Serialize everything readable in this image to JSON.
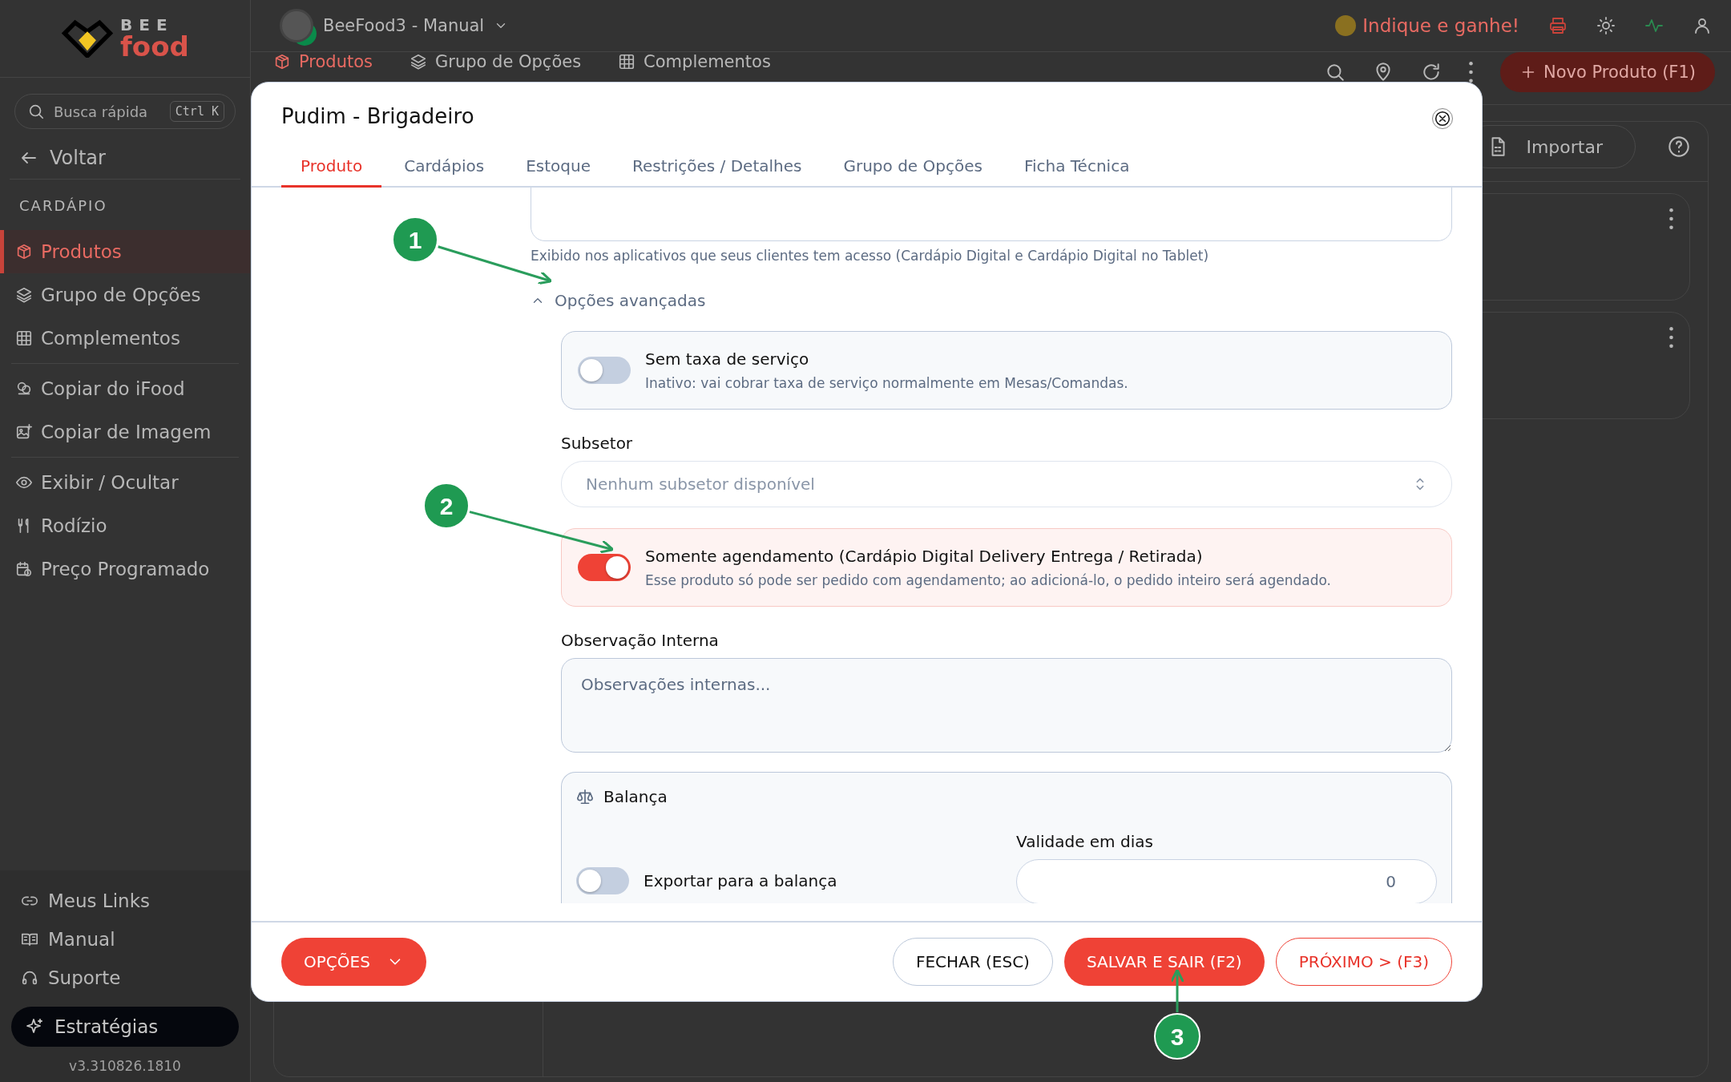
{
  "sidebar": {
    "logo": {
      "top": "BEE",
      "bottom": "food"
    },
    "search": {
      "placeholder": "Busca rápida",
      "shortcut": "Ctrl K"
    },
    "back": "Voltar",
    "section": "CARDÁPIO",
    "groups": [
      [
        {
          "label": "Produtos",
          "selected": true
        },
        {
          "label": "Grupo de Opções",
          "selected": false
        },
        {
          "label": "Complementos",
          "selected": false
        }
      ],
      [
        {
          "label": "Copiar do iFood",
          "selected": false
        },
        {
          "label": "Copiar de Imagem",
          "selected": false
        }
      ],
      [
        {
          "label": "Exibir / Ocultar",
          "selected": false
        },
        {
          "label": "Rodízio",
          "selected": false
        },
        {
          "label": "Preço Programado",
          "selected": false
        }
      ]
    ],
    "footer_links": [
      "Meus Links",
      "Manual",
      "Suporte"
    ],
    "strategy_button": "Estratégias",
    "version": "v3.310826.1810"
  },
  "topbar": {
    "workspace": "BeeFood3 - Manual",
    "referral": "Indique e ganhe!"
  },
  "page": {
    "tabs": [
      {
        "label": "Produtos",
        "selected": true
      },
      {
        "label": "Grupo de Opções",
        "selected": false
      },
      {
        "label": "Complementos",
        "selected": false
      }
    ],
    "new_button": "Novo Produto (F1)",
    "import_button": "Importar",
    "cards": [
      {
        "kind": "product"
      },
      {
        "kind": "product"
      }
    ]
  },
  "modal": {
    "title": "Pudim - Brigadeiro",
    "tabs": [
      {
        "label": "Produto",
        "selected": true
      },
      {
        "label": "Cardápios",
        "selected": false
      },
      {
        "label": "Estoque",
        "selected": false
      },
      {
        "label": "Restrições / Detalhes",
        "selected": false
      },
      {
        "label": "Grupo de Opções",
        "selected": false
      },
      {
        "label": "Ficha Técnica",
        "selected": false
      }
    ],
    "description_hint": "Exibido nos aplicativos que seus clientes tem acesso (Cardápio Digital e Cardápio Digital no Tablet)",
    "advanced": {
      "label": "Opções avançadas",
      "expanded": true
    },
    "service_fee": {
      "title": "Sem taxa de serviço",
      "hint": "Inativo: vai cobrar taxa de serviço normalmente em Mesas/Comandas.",
      "on": false
    },
    "subsector": {
      "label": "Subsetor",
      "placeholder": "Nenhum subsetor disponível"
    },
    "scheduling": {
      "title": "Somente agendamento (Cardápio Digital Delivery Entrega / Retirada)",
      "hint": "Esse produto só pode ser pedido com agendamento; ao adicioná-lo, o pedido inteiro será agendado.",
      "on": true
    },
    "internal_note": {
      "label": "Observação Interna",
      "placeholder": "Observações internas..."
    },
    "scale": {
      "title": "Balança",
      "export": {
        "title": "Exportar para a balança",
        "on": false
      },
      "validity": {
        "label": "Validade em dias",
        "value": "0"
      }
    },
    "footer": {
      "options_button": "OPÇÕES",
      "close_button": "FECHAR (ESC)",
      "save_button": "SALVAR E SAIR (F2)",
      "next_button": "PRÓXIMO > (F3)"
    }
  },
  "annotations": [
    {
      "number": "1"
    },
    {
      "number": "2"
    },
    {
      "number": "3"
    }
  ]
}
